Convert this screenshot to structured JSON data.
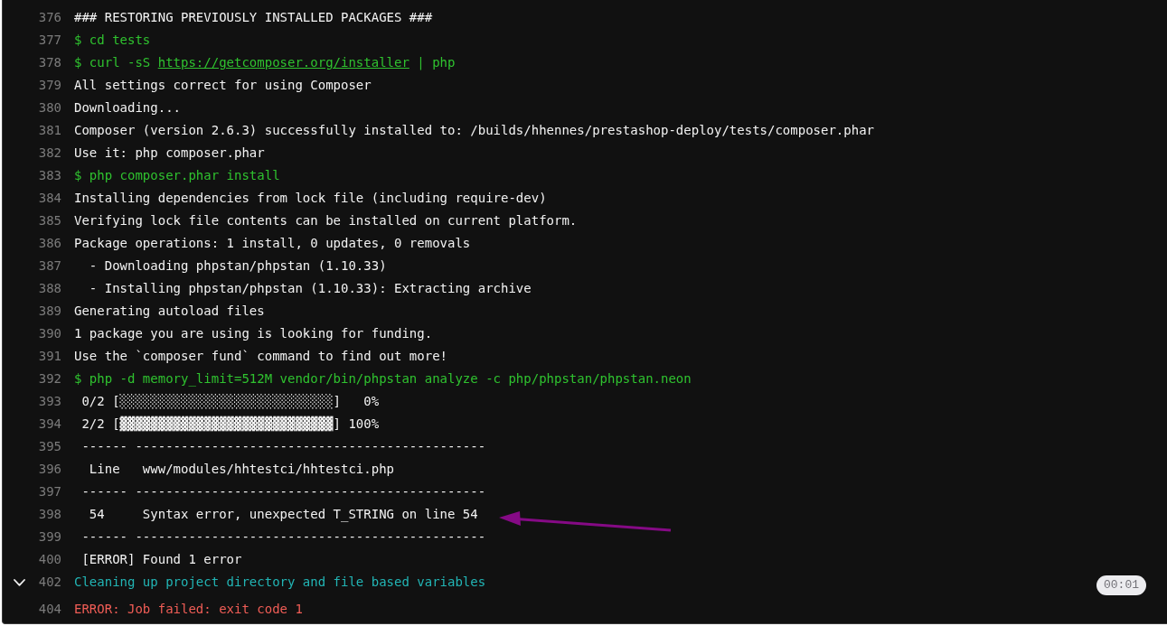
{
  "log": {
    "lines": [
      {
        "number": "376",
        "kind": "output",
        "text": "### RESTORING PREVIOUSLY INSTALLED PACKAGES ###"
      },
      {
        "number": "377",
        "kind": "command",
        "text": "$ cd tests"
      },
      {
        "number": "378",
        "kind": "command",
        "parts": [
          {
            "kind": "text",
            "text": "$ curl -sS "
          },
          {
            "kind": "link",
            "text": "https://getcomposer.org/installer"
          },
          {
            "kind": "text",
            "text": " | php"
          }
        ]
      },
      {
        "number": "379",
        "kind": "output",
        "text": "All settings correct for using Composer"
      },
      {
        "number": "380",
        "kind": "output",
        "text": "Downloading..."
      },
      {
        "number": "381",
        "kind": "output",
        "text": "Composer (version 2.6.3) successfully installed to: /builds/hhennes/prestashop-deploy/tests/composer.phar"
      },
      {
        "number": "382",
        "kind": "output",
        "text": "Use it: php composer.phar"
      },
      {
        "number": "383",
        "kind": "command",
        "text": "$ php composer.phar install"
      },
      {
        "number": "384",
        "kind": "output",
        "text": "Installing dependencies from lock file (including require-dev)"
      },
      {
        "number": "385",
        "kind": "output",
        "text": "Verifying lock file contents can be installed on current platform."
      },
      {
        "number": "386",
        "kind": "output",
        "text": "Package operations: 1 install, 0 updates, 0 removals"
      },
      {
        "number": "387",
        "kind": "output",
        "text": "  - Downloading phpstan/phpstan (1.10.33)"
      },
      {
        "number": "388",
        "kind": "output",
        "text": "  - Installing phpstan/phpstan (1.10.33): Extracting archive"
      },
      {
        "number": "389",
        "kind": "output",
        "text": "Generating autoload files"
      },
      {
        "number": "390",
        "kind": "output",
        "text": "1 package you are using is looking for funding."
      },
      {
        "number": "391",
        "kind": "output",
        "text": "Use the `composer fund` command to find out more!"
      },
      {
        "number": "392",
        "kind": "command",
        "text": "$ php -d memory_limit=512M vendor/bin/phpstan analyze -c php/phpstan/phpstan.neon"
      },
      {
        "number": "393",
        "kind": "output",
        "text": " 0/2 [░░░░░░░░░░░░░░░░░░░░░░░░░░░░]   0%"
      },
      {
        "number": "394",
        "kind": "output",
        "text": " 2/2 [▓▓▓▓▓▓▓▓▓▓▓▓▓▓▓▓▓▓▓▓▓▓▓▓▓▓▓▓] 100%"
      },
      {
        "number": "395",
        "kind": "output",
        "text": " ------ ----------------------------------------------"
      },
      {
        "number": "396",
        "kind": "output",
        "text": "  Line   www/modules/hhtestci/hhtestci.php"
      },
      {
        "number": "397",
        "kind": "output",
        "text": " ------ ----------------------------------------------"
      },
      {
        "number": "398",
        "kind": "output",
        "text": "  54     Syntax error, unexpected T_STRING on line 54"
      },
      {
        "number": "399",
        "kind": "output",
        "text": " ------ ----------------------------------------------"
      },
      {
        "number": "400",
        "kind": "output",
        "text": " [ERROR] Found 1 error"
      },
      {
        "number": "402",
        "kind": "section",
        "text": "Cleaning up project directory and file based variables",
        "expanded": true,
        "duration": "00:01"
      },
      {
        "number": "404",
        "kind": "error",
        "text": "ERROR: Job failed: exit code 1"
      }
    ]
  },
  "annotation": {
    "kind": "arrow"
  }
}
